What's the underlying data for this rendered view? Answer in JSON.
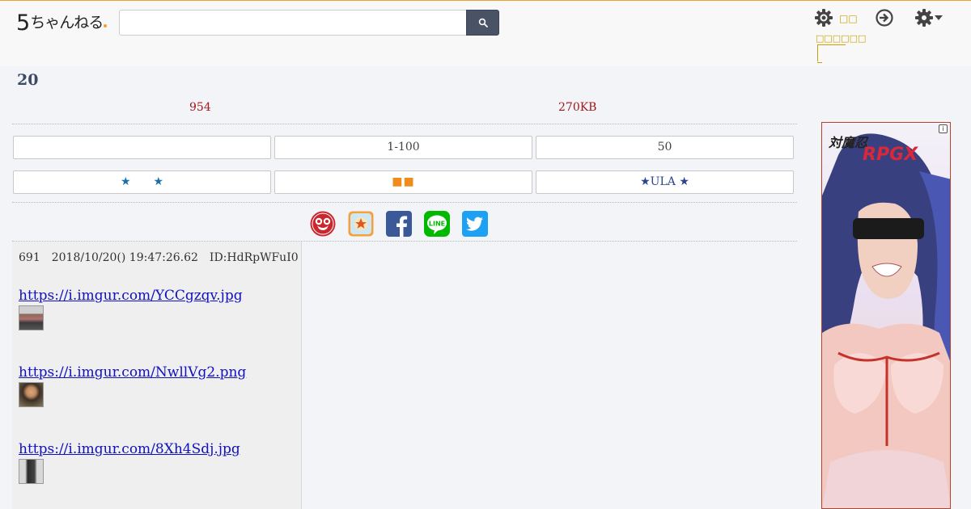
{
  "header": {
    "logo_main": "5",
    "logo_rest": "ちゃんねる",
    "search": {
      "value": "",
      "placeholder": ""
    },
    "kanji_label": "□□",
    "sub_label": "□□□□□□"
  },
  "thread": {
    "title": "20",
    "posts_count": "954",
    "size": "270KB"
  },
  "nav_row1": [
    "",
    "1-100",
    "50"
  ],
  "nav_row2": [
    "★　　★",
    "■■",
    "★ULA ★"
  ],
  "share": [
    "5ch-icon",
    "bookmark-icon",
    "facebook-icon",
    "line-icon",
    "twitter-icon"
  ],
  "post": {
    "header": "691　2018/10/20() 19:47:26.62　ID:HdRpWFuI0",
    "links": [
      "https://i.imgur.com/YCCgzqv.jpg",
      "https://i.imgur.com/NwllVg2.png",
      "https://i.imgur.com/8Xh4Sdj.jpg"
    ]
  },
  "ad": {
    "info": "i"
  },
  "colors": {
    "accent": "#f0a030",
    "search_button": "#4a5266",
    "meta_red": "#a01818"
  }
}
